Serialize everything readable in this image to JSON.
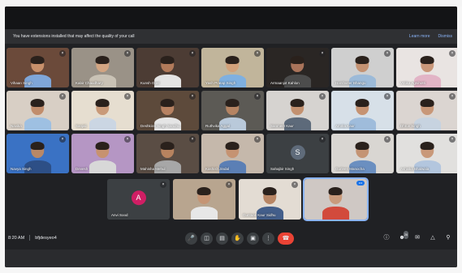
{
  "banner": {
    "message": "You have extensions installed that may affect the quality of your call",
    "learn_more": "Learn more",
    "dismiss": "Dismiss"
  },
  "tiles": [
    {
      "name": "Vihaan Singh",
      "muted": true,
      "bg": "#6b4a3a",
      "skin": "#c7906b",
      "shirt": "#7fa6d8"
    },
    {
      "name": "Kabir Chaudhary",
      "muted": true,
      "bg": "#9a9287",
      "skin": "#d3a582",
      "shirt": "#c9c2b5"
    },
    {
      "name": "Kunsh Goel",
      "muted": true,
      "bg": "#4c3c34",
      "skin": "#b17a5a",
      "shirt": "#e4e4e4"
    },
    {
      "name": "Yash Pratap Singh",
      "muted": true,
      "bg": "#c1b59b",
      "skin": "#d2a17a",
      "shirt": "#7fb0e0"
    },
    {
      "name": "Armaanjot Kahlon",
      "muted": true,
      "bg": "#2a2624",
      "skin": "#a9735a",
      "shirt": "#4c4c4c"
    },
    {
      "name": "Harshveer Bhangu",
      "muted": true,
      "bg": "#cfcfcf",
      "skin": "#c49272",
      "shirt": "#9cbad8"
    },
    {
      "name": "Vritika Agnihotri",
      "muted": true,
      "bg": "#e9e4e2",
      "skin": "#c9977a",
      "shirt": "#e2b4c6"
    },
    {
      "name": "Navika",
      "muted": true,
      "bg": "#d8cfc5",
      "skin": "#c18d6c",
      "shirt": "#9ec0e2"
    },
    {
      "name": "Sanjali",
      "muted": true,
      "bg": "#e6ded0",
      "skin": "#c99a79",
      "shirt": "#cbd6e3"
    },
    {
      "name": "Deshkirat Singh Sandhu",
      "muted": true,
      "bg": "#5d4a3b",
      "skin": "#b78262",
      "shirt": "#e5e5e5"
    },
    {
      "name": "Ruthvika Aggal",
      "muted": true,
      "bg": "#5c5a55",
      "skin": "#b58463",
      "shirt": "#b9c9da"
    },
    {
      "name": "Sanmeet Kaur",
      "muted": true,
      "bg": "#d6d3d0",
      "skin": "#c39170",
      "shirt": "#5d6a7a"
    },
    {
      "name": "Amrita Kaur",
      "muted": true,
      "bg": "#d7e0e8",
      "skin": "#c69372",
      "shirt": "#9fbcdb"
    },
    {
      "name": "Dhruv Singh",
      "muted": true,
      "bg": "#dbd5d1",
      "skin": "#c89778",
      "shirt": "#c7d3e0"
    },
    {
      "name": "Navya Singh",
      "muted": true,
      "bg": "#3a72c4",
      "skin": "#b98867",
      "shirt": "#2d4f86"
    },
    {
      "name": "Devesh",
      "muted": true,
      "bg": "#b596c4",
      "skin": "#c79270",
      "shirt": "#d8d8d8"
    },
    {
      "name": "Mahisha Mehul",
      "muted": true,
      "bg": "#5a4d44",
      "skin": "#b7835f",
      "shirt": "#a7a7a7"
    },
    {
      "name": "Kashish Jindal",
      "muted": true,
      "bg": "#c5b8ab",
      "skin": "#c59372",
      "shirt": "#5b7fb5"
    },
    {
      "name": "Sahajbir Singh",
      "muted": true,
      "avatar": "S",
      "avatar_color": "#5f6b7a",
      "bg": "#3c4043"
    },
    {
      "name": "Gurleen Manocha",
      "muted": true,
      "bg": "#d9d6d2",
      "skin": "#c49474",
      "shirt": "#6b8fc0"
    },
    {
      "name": "Ashvika Bhalwala",
      "muted": true,
      "bg": "#e1e0de",
      "skin": "#c9997a",
      "shirt": "#b3c6de"
    },
    {
      "name": "Anvi Sood",
      "muted": true,
      "avatar": "A",
      "avatar_color": "#d01e64",
      "bg": "#3c4043"
    },
    {
      "name": "",
      "muted": true,
      "bg": "#b8a58f",
      "skin": "#c59575",
      "shirt": "#e7e7e7"
    },
    {
      "name": "Guntaas Kaur Sidhu",
      "muted": true,
      "bg": "#e3dcd3",
      "skin": "#b78564",
      "shirt": "#435e8a"
    },
    {
      "name": "",
      "muted": false,
      "active": true,
      "bg": "#cfc8c4",
      "skin": "#c99a7b",
      "shirt": "#d24a3c"
    }
  ],
  "bottom": {
    "time": "8:20 AM",
    "meeting_code": "bfjdesyeo4",
    "participants_badge": "26"
  },
  "icons": {
    "mic": "mic-icon",
    "camera": "camera-icon",
    "captions": "captions-icon",
    "hand": "raise-hand-icon",
    "present": "present-icon",
    "more": "more-options-icon",
    "end": "end-call-icon",
    "info": "info-icon",
    "people": "people-icon",
    "chat": "chat-icon",
    "activities": "activities-icon",
    "lock": "host-controls-icon"
  }
}
